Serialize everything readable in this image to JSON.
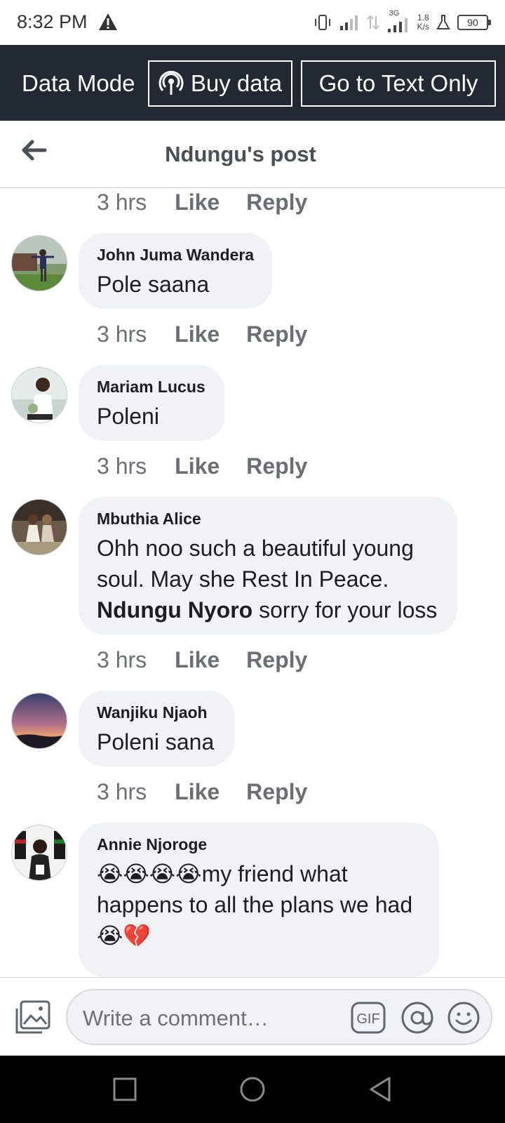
{
  "status_bar": {
    "time": "8:32 PM",
    "network_type": "3G",
    "speed_value": "1.8",
    "speed_unit": "K/s",
    "battery": "90",
    "icons": [
      "warning-icon",
      "vibrate-icon",
      "signal-icon",
      "data-transfer-icon",
      "signal-3g-icon",
      "lab-icon",
      "battery-icon"
    ]
  },
  "data_bar": {
    "mode_label": "Data Mode",
    "buy_data_label": "Buy data",
    "text_only_label": "Go to Text Only"
  },
  "header": {
    "title": "Ndungu's post"
  },
  "first_meta": {
    "time": "3 hrs",
    "like": "Like",
    "reply": "Reply"
  },
  "comments": [
    {
      "author": "John Juma Wandera",
      "text": "Pole saana",
      "time": "3 hrs",
      "like": "Like",
      "reply": "Reply"
    },
    {
      "author": "Mariam Lucus",
      "text": "Poleni",
      "time": "3 hrs",
      "like": "Like",
      "reply": "Reply"
    },
    {
      "author": "Mbuthia Alice",
      "text_line1": "Ohh noo such a beautiful young",
      "text_line2": "soul. May she Rest In Peace.",
      "mention": "Ndungu Nyoro",
      "text_line3_rest": " sorry for your loss",
      "time": "3 hrs",
      "like": "Like",
      "reply": "Reply"
    },
    {
      "author": "Wanjiku Njaoh",
      "text": "Poleni sana",
      "time": "3 hrs",
      "like": "Like",
      "reply": "Reply"
    },
    {
      "author": "Annie Njoroge",
      "emoji_lead": "😭😭😭😭",
      "text_line1_rest": "my friend what",
      "text_line2": "happens to all the plans we had",
      "emoji_trail": "😭💔"
    }
  ],
  "composer": {
    "placeholder": "Write a comment…",
    "gif_label": "GIF",
    "icons": [
      "photo-icon",
      "gif-icon",
      "mention-icon",
      "emoji-icon"
    ]
  },
  "nav_bar": {
    "icons": [
      "recents-icon",
      "home-icon",
      "back-icon"
    ]
  },
  "colors": {
    "data_bar_bg": "#222933",
    "bubble_bg": "#f0f2f5",
    "meta_text": "#6b6f75"
  }
}
